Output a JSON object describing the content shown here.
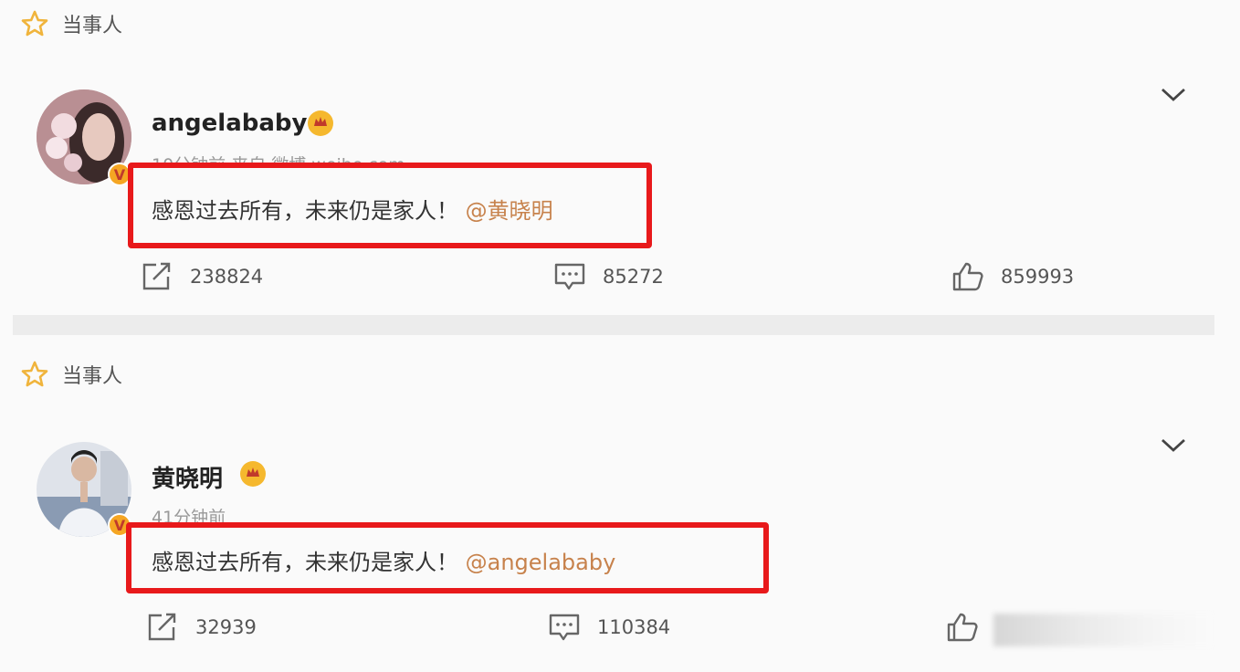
{
  "posts": [
    {
      "tag_label": "当事人",
      "username": "angelababy",
      "meta": "10分钟前 来自 微博 weibo.com",
      "content_text": "感恩过去所有，未来仍是家人！",
      "mention": "@黄晓明",
      "repost_count": "238824",
      "comment_count": "85272",
      "like_count": "859993"
    },
    {
      "tag_label": "当事人",
      "username": "黄晓明",
      "meta": "41分钟前",
      "content_text": "感恩过去所有，未来仍是家人！",
      "mention": "@angelababy",
      "repost_count": "32939",
      "comment_count": "110384",
      "like_count": ""
    }
  ],
  "colors": {
    "highlight_box": "#e8191b",
    "mention": "#c7824c",
    "star": "#f0b43c",
    "badge": "#f5a623"
  },
  "icons": [
    "star-icon",
    "verified-icon",
    "crown-icon",
    "chevron-down-icon",
    "repost-icon",
    "comment-icon",
    "like-icon"
  ]
}
